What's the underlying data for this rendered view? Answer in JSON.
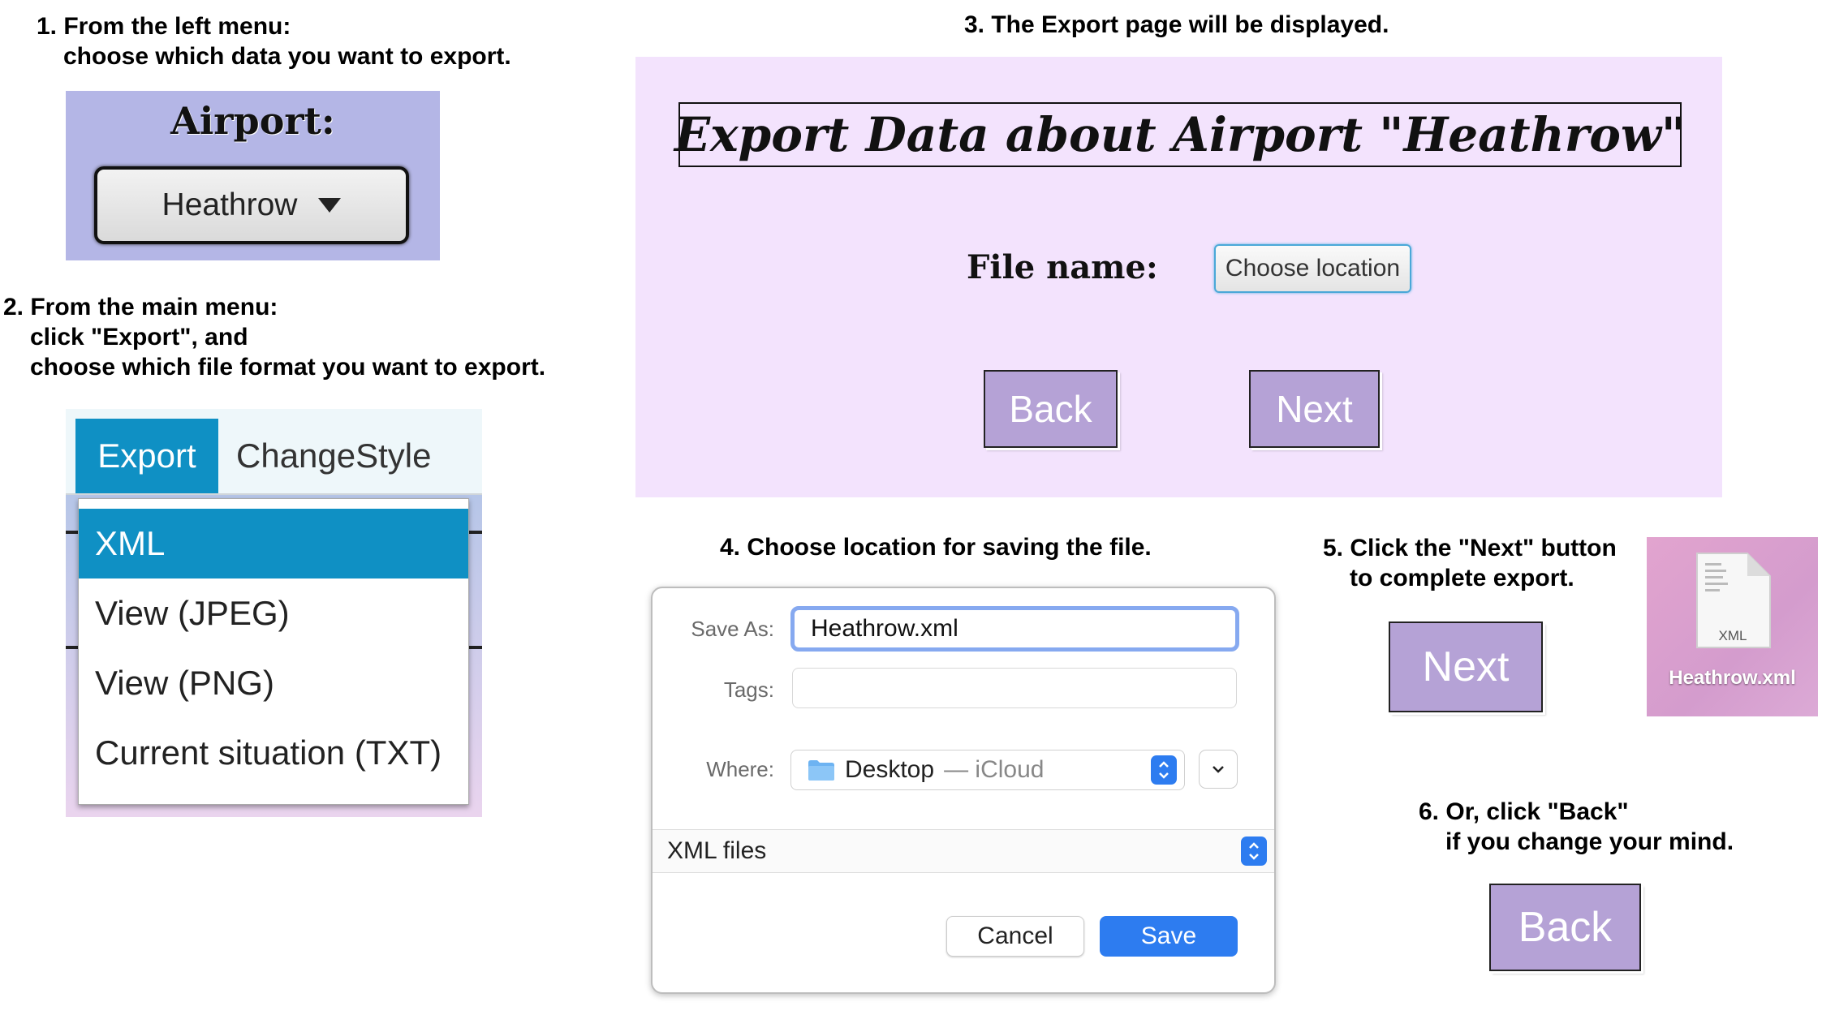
{
  "step1": {
    "line1": "1. From the left menu:",
    "line2": "choose which data you want to export.",
    "airport_label": "Airport:",
    "airport_value": "Heathrow",
    "dropdown_icon": "triangle-down-icon"
  },
  "step2": {
    "line1": "2. From the main menu:",
    "line2": "click \"Export\", and",
    "line3": "choose which file format you want to export.",
    "menu": {
      "export_label": "Export",
      "changestyle_label": "ChangeStyle"
    },
    "dropdown_items": [
      "XML",
      "View (JPEG)",
      "View (PNG)",
      "Current situation (TXT)"
    ],
    "selected_item": "XML"
  },
  "step3": {
    "line1": "3. The Export page will be displayed.",
    "page_title": "Export Data about Airport \"Heathrow\"",
    "file_name_label": "File name:",
    "choose_location_label": "Choose location",
    "back_label": "Back",
    "next_label": "Next"
  },
  "step4": {
    "line1": "4. Choose location for saving the file.",
    "save_as_label": "Save As:",
    "save_as_value": "Heathrow.xml",
    "tags_label": "Tags:",
    "tags_value": "",
    "where_label": "Where:",
    "where_value": "Desktop",
    "where_sub": "— iCloud",
    "file_type": "XML files",
    "cancel_label": "Cancel",
    "save_label": "Save"
  },
  "step5": {
    "line1": "5. Click the \"Next\" button",
    "line2": "to complete export.",
    "next_label": "Next",
    "file_icon_text": "XML",
    "file_name": "Heathrow.xml"
  },
  "step6": {
    "line1": "6. Or, click \"Back\"",
    "line2": "if you change your mind.",
    "back_label": "Back"
  },
  "colors": {
    "airport_panel_bg": "#b4b6e6",
    "menu_accent": "#0f90c4",
    "export_page_bg": "#f3e3fd",
    "purple_button": "#b5a2d6",
    "mac_blue": "#2d7cf0"
  }
}
